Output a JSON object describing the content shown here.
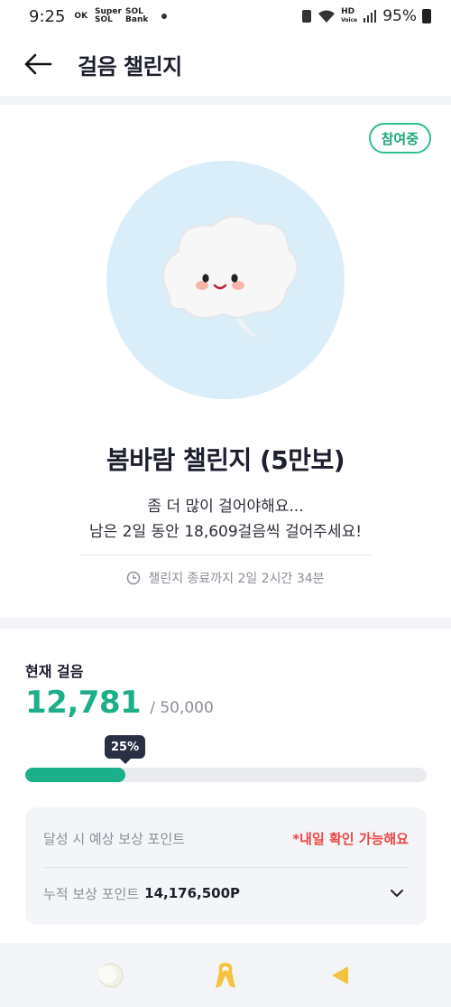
{
  "status_bar": {
    "time": "9:25",
    "ok_label": "OK",
    "sol1": "Super SOL",
    "sol2": "SOL Bank",
    "hd": "HD",
    "voice": "Voice",
    "battery": "95%"
  },
  "header": {
    "title": "걸음 챌린지",
    "back_icon": "arrow-left-icon"
  },
  "challenge": {
    "badge": "참여중",
    "character_icon": "cloud-character-icon",
    "title": "봄바람 챌린지 (5만보)",
    "message_line1": "좀 더 많이 걸어야해요...",
    "message_line2": "남은 2일 동안 18,609걸음씩 걸어주세요!",
    "end_text": "챌린지 종료까지 2일 2시간 34분",
    "clock_icon": "clock-icon"
  },
  "steps": {
    "label": "현재 걸음",
    "current": "12,781",
    "goal": "/ 50,000",
    "percent_label": "25%",
    "progress": 0.25,
    "accent": "#1bb08a"
  },
  "reward": {
    "expected_label": "달성 시 예상 보상 포인트",
    "expected_note": "*내일 확인 가능해요",
    "cumulative_label": "누적 보상 포인트",
    "cumulative_value": "14,176,500P",
    "chevron_icon": "chevron-down-icon",
    "note_color": "#ee4545"
  },
  "bottom_nav": {
    "items": [
      "moon-icon",
      "ribbon-icon",
      "back-triangle-icon"
    ]
  }
}
